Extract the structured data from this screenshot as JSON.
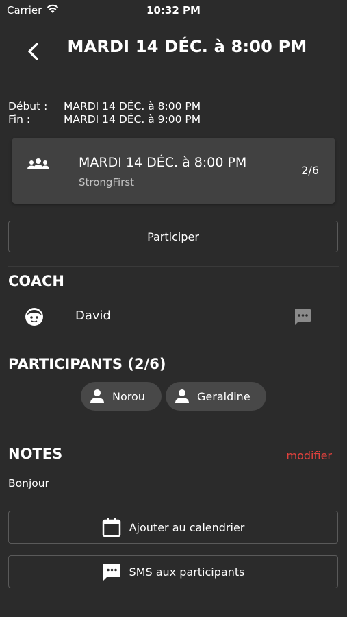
{
  "status_bar": {
    "carrier": "Carrier",
    "time": "10:32 PM"
  },
  "header": {
    "title": "MARDI 14 DÉC. à 8:00 PM"
  },
  "dates": {
    "start_label": "Début :",
    "start_value": "MARDI 14 DÉC. à 8:00 PM",
    "end_label": "Fin :",
    "end_value": "MARDI 14 DÉC. à 9:00 PM"
  },
  "session_card": {
    "title": "MARDI 14 DÉC. à 8:00 PM",
    "subtitle": "StrongFirst",
    "count": "2/6"
  },
  "participate_button": "Participer",
  "coach": {
    "heading": "COACH",
    "name": "David"
  },
  "participants": {
    "heading": "PARTICIPANTS (2/6)",
    "items": [
      "Norou",
      "Geraldine"
    ]
  },
  "notes": {
    "heading": "NOTES",
    "modify_label": "modifier",
    "text": "Bonjour"
  },
  "actions": {
    "calendar_label": "Ajouter au calendrier",
    "sms_label": "SMS aux participants"
  },
  "colors": {
    "background": "#2b2b2b",
    "card": "#414141",
    "accent": "#e0413d"
  }
}
